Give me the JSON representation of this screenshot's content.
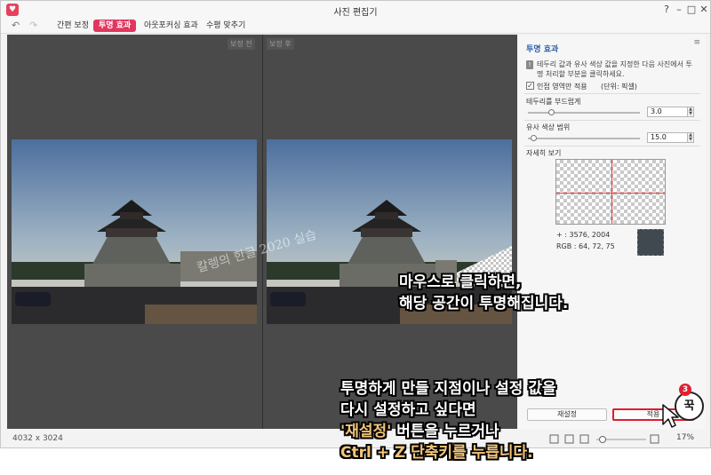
{
  "window": {
    "title": "사진 편집기",
    "logo_glyph": "♥",
    "help_glyph": "?",
    "minimize_glyph": "–",
    "maximize_glyph": "□",
    "close_glyph": "✕"
  },
  "toolbar": {
    "undo_glyph": "↶",
    "redo_glyph": "↷",
    "tabs": [
      {
        "label": "간편 보정",
        "active": false
      },
      {
        "label": "투명 효과",
        "active": true
      },
      {
        "label": "아웃포커싱 효과",
        "active": false
      },
      {
        "label": "수평 맞추기",
        "active": false
      }
    ]
  },
  "workspace": {
    "before_label": "보정 전",
    "after_label": "보정 후",
    "watermark": "칼렝의 한글 2020 실습"
  },
  "status": {
    "dimensions": "4032 x 3024",
    "zoom_percent": "17%"
  },
  "panel": {
    "title": "투명 효과",
    "menu_glyph": "≡",
    "warning_glyph": "!",
    "info_text": "테두리 값과 유사 색상 값을 지정한 다음 사진에서 투명 처리할 부분을 클릭하세요.",
    "adjacent_only_label": "인접 영역만 적용",
    "adjacent_only_checked": true,
    "check_glyph": "✓",
    "unit_text": "(단위: 픽셀)",
    "edge_soften_label": "테두리를 부드럽게",
    "edge_soften_value": "3.0",
    "similar_color_label": "유사 색상 범위",
    "similar_color_value": "15.0",
    "spin_up": "▲",
    "spin_down": "▼",
    "detail_label": "자세히 보기",
    "coord_text": "+ : 3576, 2004",
    "rgb_text": "RGB : 64, 72, 75",
    "swatch_color": "#404850",
    "reset_button": "재설정",
    "apply_button": "적용"
  },
  "annotation": {
    "line1": "마우스로 클릭하면,",
    "line2": "해당 공간이 투명해집니다.",
    "line3": "투명하게 만들 지점이나 설정 값을",
    "line4": "다시 설정하고 싶다면",
    "line5_highlight": "'재설정'",
    "line5_rest": " 버튼을 누르거나",
    "line6": "Ctrl + Z 단축키를 누릅니다.",
    "step_number": "3",
    "stamp_text": "꾹",
    "accent_color": "#e11c2c"
  }
}
